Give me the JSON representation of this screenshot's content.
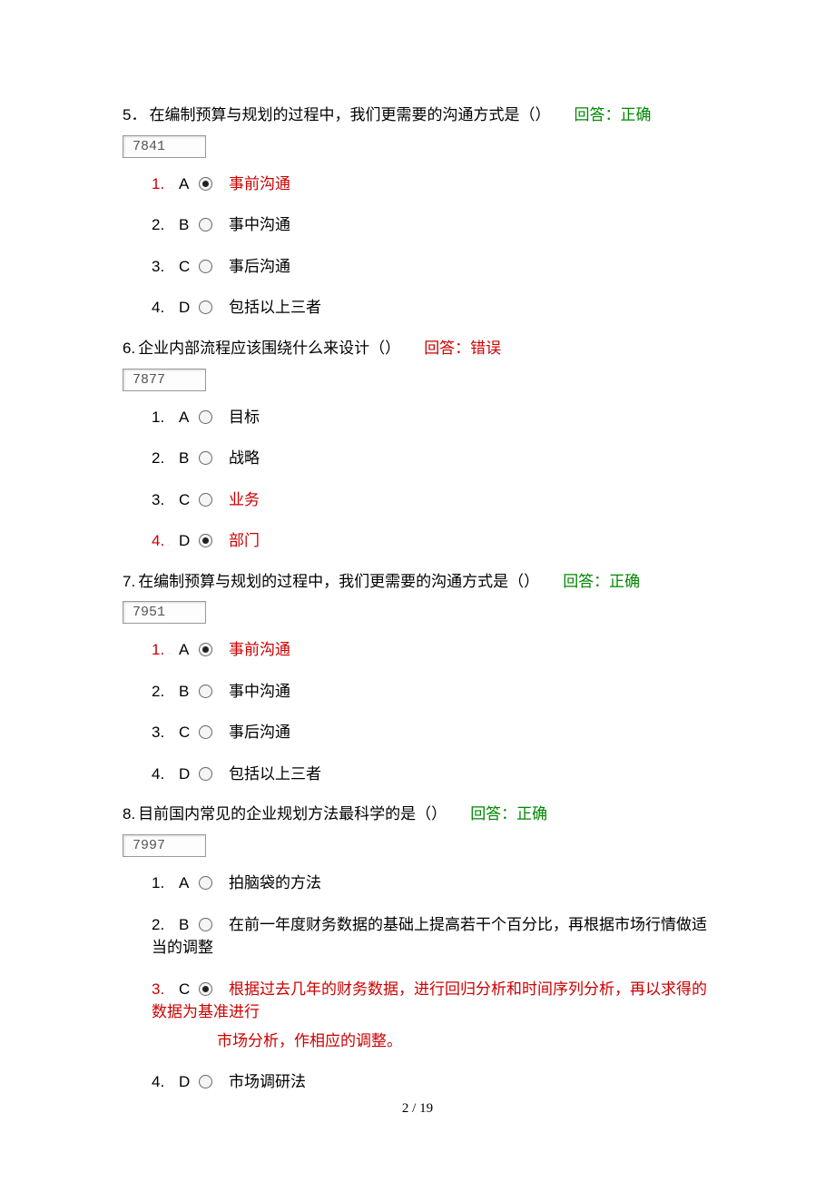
{
  "footer": {
    "current": "2",
    "sep": " / ",
    "total": "19"
  },
  "feedback_label": {
    "correct": "回答：正确",
    "wrong": "回答：错误"
  },
  "questions": [
    {
      "num": "5．",
      "stem": "在编制预算与规划的过程中，我们更需要的沟通方式是（）",
      "result": "correct",
      "id_box": "7841",
      "options": [
        {
          "ord": "1.",
          "letter": "A",
          "text": "事前沟通",
          "selected": true,
          "highlight_text": true,
          "highlight_ord": true
        },
        {
          "ord": "2.",
          "letter": "B",
          "text": "事中沟通",
          "selected": false,
          "highlight_text": false,
          "highlight_ord": false
        },
        {
          "ord": "3.",
          "letter": "C",
          "text": "事后沟通",
          "selected": false,
          "highlight_text": false,
          "highlight_ord": false
        },
        {
          "ord": "4.",
          "letter": "D",
          "text": "包括以上三者",
          "selected": false,
          "highlight_text": false,
          "highlight_ord": false
        }
      ]
    },
    {
      "num": "6.",
      "stem": "企业内部流程应该围绕什么来设计（）",
      "result": "wrong",
      "id_box": "7877",
      "options": [
        {
          "ord": "1.",
          "letter": "A",
          "text": "目标",
          "selected": false,
          "highlight_text": false,
          "highlight_ord": false
        },
        {
          "ord": "2.",
          "letter": "B",
          "text": "战略",
          "selected": false,
          "highlight_text": false,
          "highlight_ord": false
        },
        {
          "ord": "3.",
          "letter": "C",
          "text": "业务",
          "selected": false,
          "highlight_text": true,
          "highlight_ord": false
        },
        {
          "ord": "4.",
          "letter": "D",
          "text": "部门",
          "selected": true,
          "highlight_text": true,
          "highlight_ord": true
        }
      ]
    },
    {
      "num": "7.",
      "stem": "在编制预算与规划的过程中，我们更需要的沟通方式是（）",
      "result": "correct",
      "id_box": "7951",
      "options": [
        {
          "ord": "1.",
          "letter": "A",
          "text": "事前沟通",
          "selected": true,
          "highlight_text": true,
          "highlight_ord": true
        },
        {
          "ord": "2.",
          "letter": "B",
          "text": "事中沟通",
          "selected": false,
          "highlight_text": false,
          "highlight_ord": false
        },
        {
          "ord": "3.",
          "letter": "C",
          "text": "事后沟通",
          "selected": false,
          "highlight_text": false,
          "highlight_ord": false
        },
        {
          "ord": "4.",
          "letter": "D",
          "text": "包括以上三者",
          "selected": false,
          "highlight_text": false,
          "highlight_ord": false
        }
      ]
    },
    {
      "num": "8.",
      "stem": "目前国内常见的企业规划方法最科学的是（）",
      "result": "correct",
      "id_box": "7997",
      "options": [
        {
          "ord": "1.",
          "letter": "A",
          "text": "拍脑袋的方法",
          "selected": false,
          "highlight_text": false,
          "highlight_ord": false
        },
        {
          "ord": "2.",
          "letter": "B",
          "text": "在前一年度财务数据的基础上提高若干个百分比，再根据市场行情做适当的调整",
          "selected": false,
          "highlight_text": false,
          "highlight_ord": false
        },
        {
          "ord": "3.",
          "letter": "C",
          "text": "根据过去几年的财务数据，进行回归分析和时间序列分析，再以求得的数据为基准进行",
          "text2": "市场分析，作相应的调整。",
          "selected": true,
          "highlight_text": true,
          "highlight_ord": true
        },
        {
          "ord": "4.",
          "letter": "D",
          "text": "市场调研法",
          "selected": false,
          "highlight_text": false,
          "highlight_ord": false
        }
      ]
    }
  ]
}
